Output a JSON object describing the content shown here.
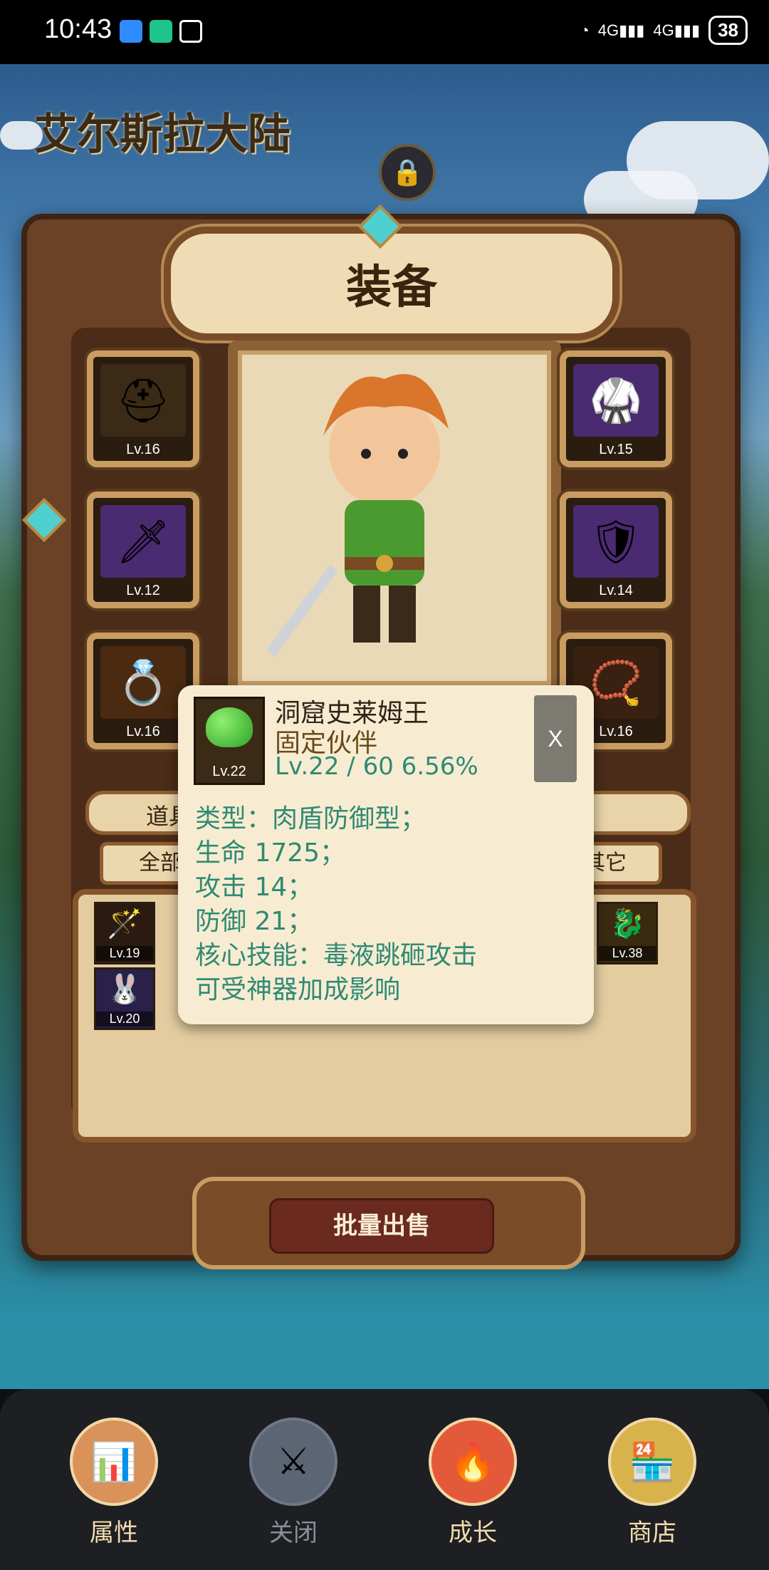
{
  "status_bar": {
    "time": "10:43",
    "network_1": "4G",
    "network_2": "4G",
    "battery": "38",
    "icons": [
      "message-icon",
      "robot-app-icon",
      "nfc-icon",
      "wifi-icon",
      "signal-icon",
      "battery-icon"
    ]
  },
  "world": {
    "title": "艾尔斯拉大陆"
  },
  "panel": {
    "title": "装备",
    "left_slots": [
      {
        "icon": "helmet-icon",
        "level": "Lv.16"
      },
      {
        "icon": "sword-icon",
        "level": "Lv.12"
      },
      {
        "icon": "ring-icon",
        "level": "Lv.16"
      }
    ],
    "right_slots": [
      {
        "icon": "armor-icon",
        "level": "Lv.15"
      },
      {
        "icon": "shield-icon",
        "level": "Lv.14"
      },
      {
        "icon": "amulet-icon",
        "level": "Lv.16"
      }
    ],
    "tab_label": "道具",
    "filter_all": "全部",
    "filter_other": "其它",
    "inventory": [
      {
        "icon": "staff-icon",
        "level": "Lv.19"
      },
      {
        "icon": "dragon-icon",
        "level": "Lv.38"
      },
      {
        "icon": "rabbit-icon",
        "level": "Lv.20"
      }
    ],
    "sell_button": "批量出售"
  },
  "popup": {
    "icon": "slime-icon",
    "icon_level": "Lv.22",
    "name": "洞窟史莱姆王",
    "subtitle": "固定伙伴",
    "level_progress": "Lv.22 / 60  6.56%",
    "close": "X",
    "lines": [
      "类型：肉盾防御型；",
      "生命 1725；",
      "攻击 14；",
      "防御 21；",
      "核心技能：毒液跳砸攻击",
      "可受神器加成影响"
    ]
  },
  "nav": [
    {
      "label": "属性",
      "icon": "bar-chart-icon",
      "color": "#d9925a"
    },
    {
      "label": "关闭",
      "icon": "crossed-swords-icon",
      "color": "#5c6574"
    },
    {
      "label": "成长",
      "icon": "flame-icon",
      "color": "#e25a3a"
    },
    {
      "label": "商店",
      "icon": "shop-icon",
      "color": "#d8b24a"
    }
  ]
}
